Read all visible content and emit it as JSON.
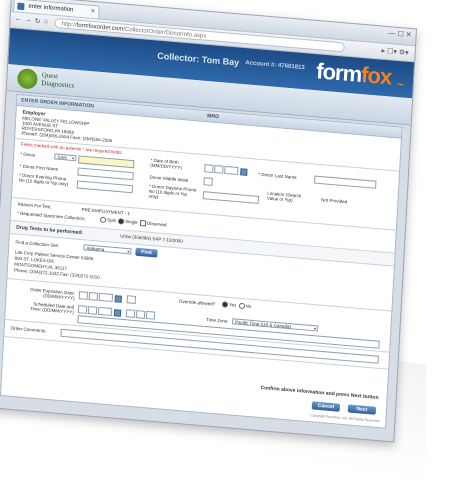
{
  "browser": {
    "tab_title": "enter information",
    "url_prefix": "http://",
    "url_domain": "formfoxorder.com",
    "url_path": "/CollectorOrder/DonorInfo.aspx"
  },
  "header": {
    "collector": "Collector: Tom Bay",
    "account": "Account #: 47681813",
    "logo_main": "form",
    "logo_accent": "fox"
  },
  "quest": {
    "line1": "Quest",
    "line2": "Diagnostics"
  },
  "form": {
    "section_title": "ENTER ORDER INFORMATION",
    "mro": "MRO",
    "employer": {
      "label": "Employer",
      "name": "MELONE VALLEY FELLOWSHIP",
      "address1": "1000 AVENUE ST",
      "address2": "ROYERSFORD,PA 19468",
      "phone": "Phone#: (264)555-2504 Fax#: (264)555-2506"
    },
    "required_note": "Fields marked with an asterisk * are required fields",
    "labels": {
      "donor": "* Donor",
      "ssn": "SSN",
      "dob": "* Date of Birth (MM/DD/YYYY)",
      "last_name": "* Donor Last Name",
      "first_name": "* Donor First Name",
      "middle": "Donor Middle Initial",
      "evening_phone": "* Donor Evening Phone No (10 digits or %p only)",
      "daytime_phone": "* Donor Daytime Phone No (10 digits or %p only)",
      "location": "Location (Search Value or %p)",
      "not_provided": "Not Provided",
      "reason": "Reason For Test:",
      "reason_value": "PRE EMPLOYMENT - 1",
      "specimen": "* Requested Specimen Collection:",
      "specimen_opts": [
        "Split",
        "Single",
        "Observed"
      ],
      "drug_tests": "Drug Tests to be performed:",
      "drug_value": "Urine (35606N) SAP 7-10/2000",
      "lab_site": "Find a Collection Site:",
      "state": "Alabama",
      "find": "Find",
      "site_name": "Lab Corp Patient Service Center 53806",
      "site_addr1": "800 ST. LUKES DR.",
      "site_addr2": "MONTGOMERY,AL 36117",
      "site_phone": "Phone: (334)272-1032 Fax: (334)272-1010",
      "expiration": "Order Expiration Date: (DD/MM/YYYY)",
      "override": "Override allowed?",
      "yes": "Yes",
      "no": "No",
      "scheduled": "Scheduled Date and Time: (DD/MM/YYYY)",
      "timezone": "Time Zone:",
      "timezone_value": "Pacific Time (US & Canada)",
      "comments": "Order Comments:",
      "confirm": "Confirm above information and press Next button",
      "cancel": "Cancel",
      "next": "Next",
      "footer": "Copyright FormFox, Inc. All Rights Reserved"
    }
  }
}
